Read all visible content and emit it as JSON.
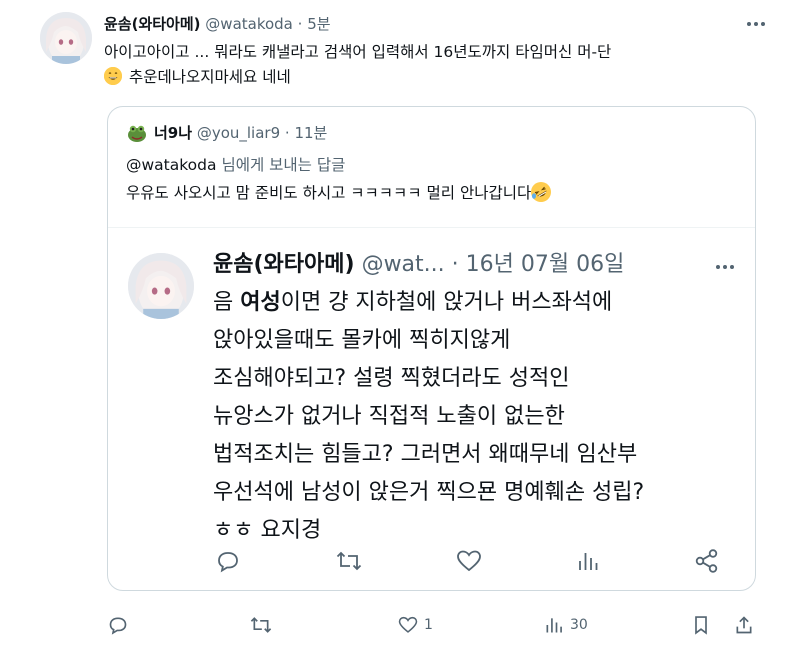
{
  "tweet": {
    "author_name": "윤솜(와타아메)",
    "author_handle": "@watakoda",
    "time": "· 5분",
    "text_line1": "아이고아이고 ... 뭐라도 캐낼라고 검색어 입력해서 16년도까지 타임머신 머-단",
    "text_line2": "추운데나오지마세요 네네",
    "emoji": "grinning-sweat-emoji"
  },
  "quote": {
    "author_name": "너9나",
    "author_handle": "@you_liar9",
    "time": "· 11분",
    "reply_to_handle": "@watakoda",
    "reply_to_suffix": "님에게 보내는 답글",
    "text": "우유도 사오시고 맘 준비도 하시고 ㅋㅋㅋㅋㅋ 멀리 안나갑니다",
    "emoji": "rofl-emoji"
  },
  "inner": {
    "author_name": "윤솜(와타아메)",
    "author_handle": "@wat...",
    "date": "· 16년 07월 06일",
    "line1_a": "음 ",
    "line1_bold": "여성",
    "line1_b": "이면 걍 지하철에 앉거나 버스좌석에",
    "line2": "앉아있을때도 몰카에 찍히지않게",
    "line3": "조심해야되고? 설령 찍혔더라도 성적인",
    "line4": "뉴앙스가 없거나 직접적 노출이 없는한",
    "line5": "법적조치는 힘들고? 그러면서 왜때무네 임산부",
    "line6": "우선석에 남성이 앉은거 찍으묜 명예훼손 성립?",
    "line7": "ㅎㅎ 요지경"
  },
  "actions": {
    "likes": "1",
    "views": "30"
  },
  "colors": {
    "text": "#0f1419",
    "muted": "#536471",
    "border": "#cfd9de"
  }
}
